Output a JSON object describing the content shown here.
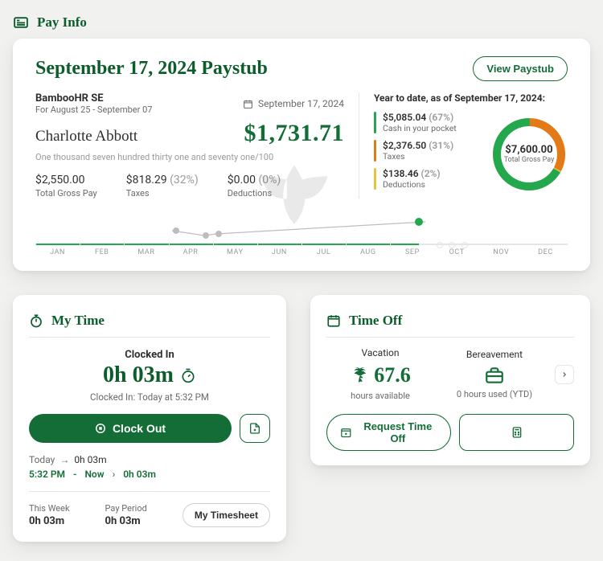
{
  "payinfo": {
    "section": "Pay Info",
    "title": "September 17, 2024 Paystub",
    "view_btn": "View Paystub",
    "company": "BambooHR SE",
    "period": "For August 25 - September 07",
    "date": "September 17, 2024",
    "employee": "Charlotte Abbott",
    "net": "$1,731.71",
    "words": "One thousand seven hundred thirty one and seventy one/100",
    "stats": [
      {
        "value": "$2,550.00",
        "pct": "",
        "label": "Total Gross Pay"
      },
      {
        "value": "$818.29",
        "pct": "(32%)",
        "label": "Taxes"
      },
      {
        "value": "$0.00",
        "pct": "(0%)",
        "label": "Deductions"
      }
    ],
    "ytd": {
      "title": "Year to date, as of September 17, 2024:",
      "items": [
        {
          "color": "#23a84e",
          "value": "$5,085.04",
          "pct": "(67%)",
          "label": "Cash in your pocket"
        },
        {
          "color": "#e27a18",
          "value": "$2,376.50",
          "pct": "(31%)",
          "label": "Taxes"
        },
        {
          "color": "#e8c23a",
          "value": "$138.46",
          "pct": "(2%)",
          "label": "Deductions"
        }
      ],
      "total": "$7,600.00",
      "total_label": "Total Gross Pay"
    },
    "months": [
      "JAN",
      "FEB",
      "MAR",
      "APR",
      "MAY",
      "JUN",
      "JUL",
      "AUG",
      "SEP",
      "OCT",
      "NOV",
      "DEC"
    ]
  },
  "mytime": {
    "section": "My Time",
    "status": "Clocked In",
    "elapsed": "0h 03m",
    "since": "Clocked In: Today at 5:32 PM",
    "clockout": "Clock Out",
    "today_label": "Today",
    "today_total": "0h 03m",
    "entry_start": "5:32 PM",
    "entry_dash": "-",
    "entry_end": "Now",
    "entry_dur": "0h 03m",
    "week_label": "This Week",
    "week_val": "0h 03m",
    "period_label": "Pay Period",
    "period_val": "0h 03m",
    "timesheet_btn": "My Timesheet"
  },
  "timeoff": {
    "section": "Time Off",
    "cats": [
      {
        "name": "Vacation",
        "value": "67.6",
        "foot": "hours available"
      },
      {
        "name": "Bereavement",
        "value": "",
        "foot": "0 hours used (YTD)"
      }
    ],
    "request_btn": "Request Time Off"
  }
}
